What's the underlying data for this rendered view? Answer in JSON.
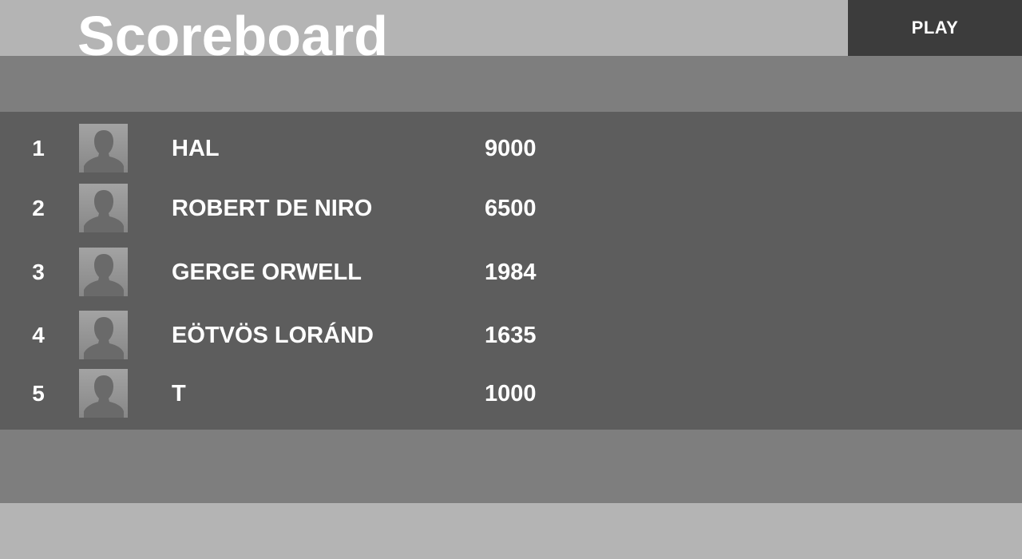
{
  "header": {
    "title": "Scoreboard",
    "play_label": "PLAY"
  },
  "players": [
    {
      "rank": "1",
      "name": "HAL",
      "score": "9000"
    },
    {
      "rank": "2",
      "name": "ROBERT DE NIRO",
      "score": "6500"
    },
    {
      "rank": "3",
      "name": "GERGE ORWELL",
      "score": "1984"
    },
    {
      "rank": "4",
      "name": "EÖTVÖS LORÁND",
      "score": "1635"
    },
    {
      "rank": "5",
      "name": "T",
      "score": "1000"
    }
  ],
  "icons": {
    "avatar": "person-silhouette-icon"
  },
  "colors": {
    "light_band": "#b4b4b4",
    "mid_band": "#7e7e7e",
    "board": "#5d5d5d",
    "play_button": "#3c3c3c",
    "text": "#ffffff"
  }
}
